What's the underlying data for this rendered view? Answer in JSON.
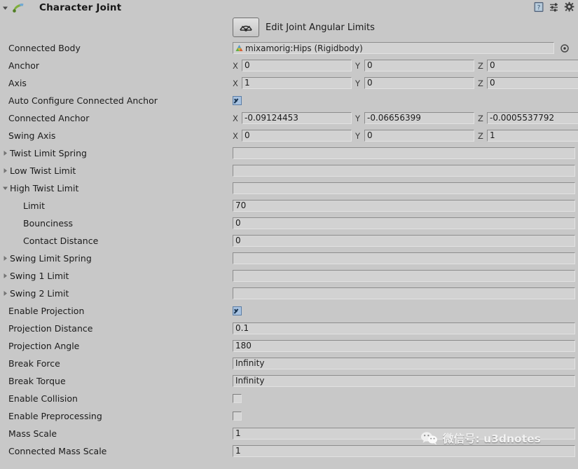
{
  "component": {
    "title": "Character Joint",
    "icon": "character-joint-icon",
    "expanded": true
  },
  "header_icons": [
    {
      "name": "help-icon",
      "glyph": "?"
    },
    {
      "name": "preset-icon",
      "glyph": "preset"
    },
    {
      "name": "gear-icon",
      "glyph": "gear"
    }
  ],
  "edit_button": {
    "icon": "joint-angular-limits-icon",
    "label": "Edit Joint Angular Limits"
  },
  "rows": [
    {
      "name": "connected-body",
      "label": "Connected Body",
      "type": "object",
      "value": "mixamorig:Hips (Rigidbody)",
      "object_icon": "rigidbody-asset-icon",
      "picker": "object-picker-icon"
    },
    {
      "name": "anchor",
      "label": "Anchor",
      "type": "vector3",
      "axes": [
        "X",
        "Y",
        "Z"
      ],
      "values": [
        "0",
        "0",
        "0"
      ]
    },
    {
      "name": "axis",
      "label": "Axis",
      "type": "vector3",
      "axes": [
        "X",
        "Y",
        "Z"
      ],
      "values": [
        "1",
        "0",
        "0"
      ]
    },
    {
      "name": "auto-configure-connected-anchor",
      "label": "Auto Configure Connected Anchor",
      "type": "checkbox",
      "checked": true
    },
    {
      "name": "connected-anchor",
      "label": "Connected Anchor",
      "type": "vector3",
      "axes": [
        "X",
        "Y",
        "Z"
      ],
      "values": [
        "-0.09124453",
        "-0.06656399",
        "-0.0005537792"
      ]
    },
    {
      "name": "swing-axis",
      "label": "Swing Axis",
      "type": "vector3",
      "axes": [
        "X",
        "Y",
        "Z"
      ],
      "values": [
        "0",
        "0",
        "1"
      ]
    },
    {
      "name": "twist-limit-spring",
      "label": "Twist Limit Spring",
      "type": "foldout",
      "expanded": false
    },
    {
      "name": "low-twist-limit",
      "label": "Low Twist Limit",
      "type": "foldout",
      "expanded": false
    },
    {
      "name": "high-twist-limit",
      "label": "High Twist Limit",
      "type": "foldout",
      "expanded": true
    },
    {
      "name": "high-twist-limit-limit",
      "label": "Limit",
      "type": "text",
      "indent": 1,
      "value": "70"
    },
    {
      "name": "high-twist-limit-bounciness",
      "label": "Bounciness",
      "type": "text",
      "indent": 1,
      "value": "0"
    },
    {
      "name": "high-twist-limit-contact-distance",
      "label": "Contact Distance",
      "type": "text",
      "indent": 1,
      "value": "0"
    },
    {
      "name": "swing-limit-spring",
      "label": "Swing Limit Spring",
      "type": "foldout",
      "expanded": false
    },
    {
      "name": "swing-1-limit",
      "label": "Swing 1 Limit",
      "type": "foldout",
      "expanded": false
    },
    {
      "name": "swing-2-limit",
      "label": "Swing 2 Limit",
      "type": "foldout",
      "expanded": false
    },
    {
      "name": "enable-projection",
      "label": "Enable Projection",
      "type": "checkbox",
      "checked": true
    },
    {
      "name": "projection-distance",
      "label": "Projection Distance",
      "type": "text",
      "value": "0.1"
    },
    {
      "name": "projection-angle",
      "label": "Projection Angle",
      "type": "text",
      "value": "180"
    },
    {
      "name": "break-force",
      "label": "Break Force",
      "type": "text",
      "value": "Infinity"
    },
    {
      "name": "break-torque",
      "label": "Break Torque",
      "type": "text",
      "value": "Infinity"
    },
    {
      "name": "enable-collision",
      "label": "Enable Collision",
      "type": "checkbox",
      "checked": false
    },
    {
      "name": "enable-preprocessing",
      "label": "Enable Preprocessing",
      "type": "checkbox",
      "checked": false
    },
    {
      "name": "mass-scale",
      "label": "Mass Scale",
      "type": "text",
      "value": "1"
    },
    {
      "name": "connected-mass-scale",
      "label": "Connected Mass Scale",
      "type": "text",
      "value": "1"
    }
  ],
  "watermark": {
    "logo": "wechat-logo-icon",
    "text": "微信号: u3dnotes"
  },
  "colors": {
    "background": "#c8c8c8",
    "field_fill": "#d2d2d2",
    "checkbox_on": "#a8c2e0",
    "text": "#1b1b1b"
  }
}
